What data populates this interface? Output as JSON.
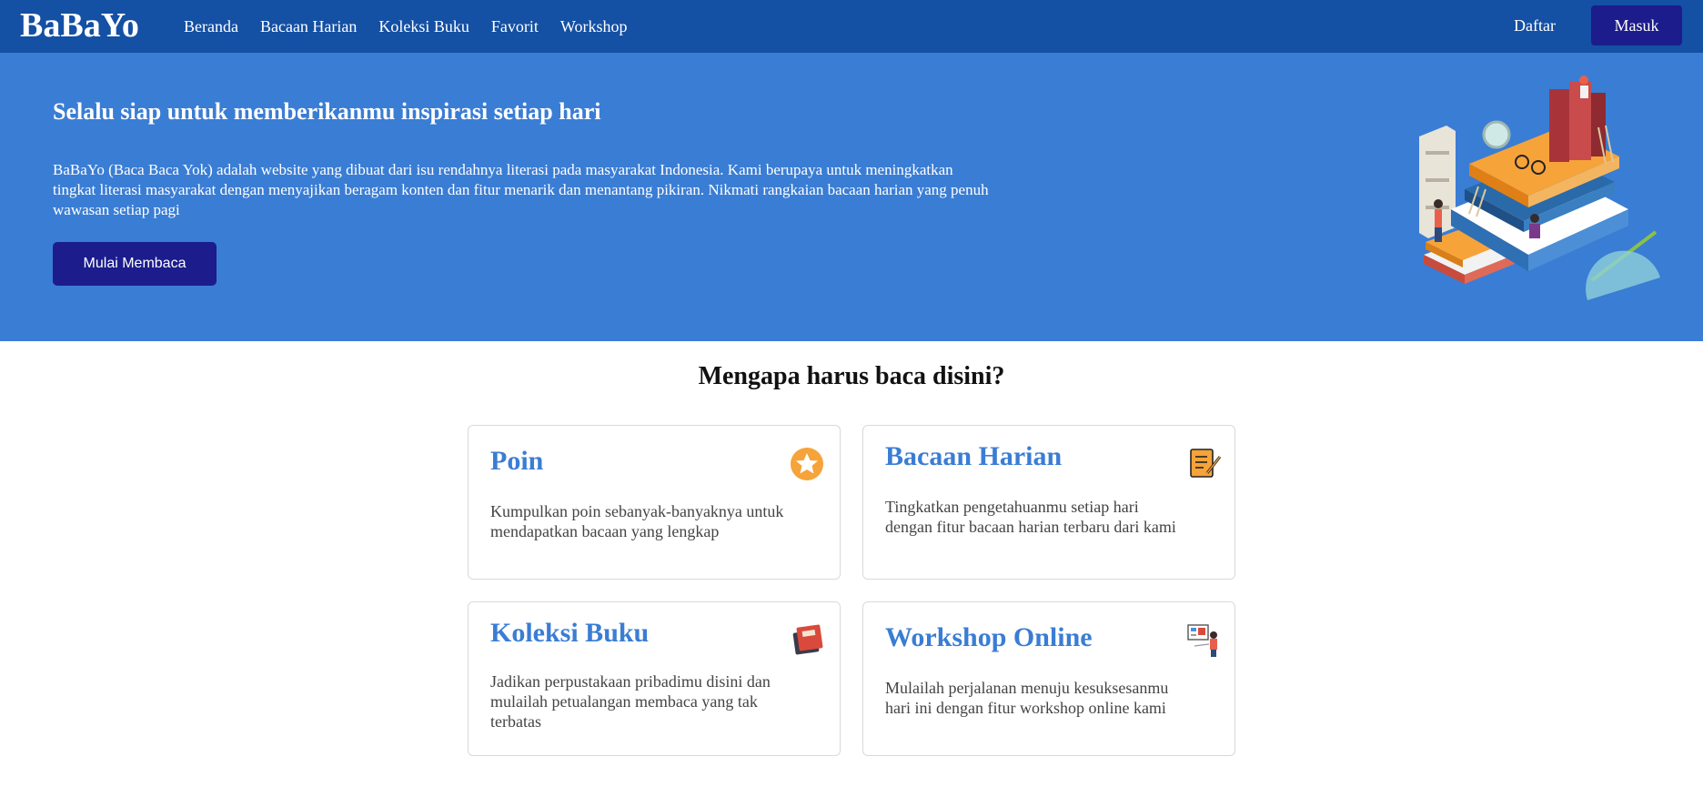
{
  "navbar": {
    "brand": "BaBaYo",
    "links": [
      "Beranda",
      "Bacaan Harian",
      "Koleksi Buku",
      "Favorit",
      "Workshop"
    ],
    "daftar": "Daftar",
    "masuk": "Masuk"
  },
  "hero": {
    "title": "Selalu siap untuk memberikanmu inspirasi setiap hari",
    "description": "BaBaYo (Baca Baca Yok) adalah website yang dibuat dari isu rendahnya literasi pada masyarakat Indonesia. Kami berupaya untuk meningkatkan tingkat literasi masyarakat dengan menyajikan beragam konten dan fitur menarik dan menantang pikiran. Nikmati rangkaian bacaan harian yang penuh wawasan setiap pagi",
    "button": "Mulai Membaca",
    "illustration_icon": "books-stack-illustration"
  },
  "features": {
    "title": "Mengapa harus baca disini?",
    "cards": [
      {
        "title": "Poin",
        "description": "Kumpulkan poin sebanyak-banyaknya untuk mendapatkan bacaan yang lengkap",
        "icon": "star-badge-icon"
      },
      {
        "title": "Bacaan Harian",
        "description": "Tingkatkan pengetahuanmu setiap hari dengan fitur bacaan harian terbaru dari kami",
        "icon": "document-pen-icon"
      },
      {
        "title": "Koleksi Buku",
        "description": "Jadikan perpustakaan pribadimu disini dan mulailah petualangan membaca yang tak terbatas",
        "icon": "books-icon"
      },
      {
        "title": "Workshop Online",
        "description": "Mulailah perjalanan menuju kesuksesanmu hari ini dengan fitur workshop online kami",
        "icon": "presentation-icon"
      }
    ]
  },
  "colors": {
    "navbar": "#1450a3",
    "hero": "#3a7dd4",
    "button": "#1c1c8c",
    "accent": "#3a7dd4"
  }
}
